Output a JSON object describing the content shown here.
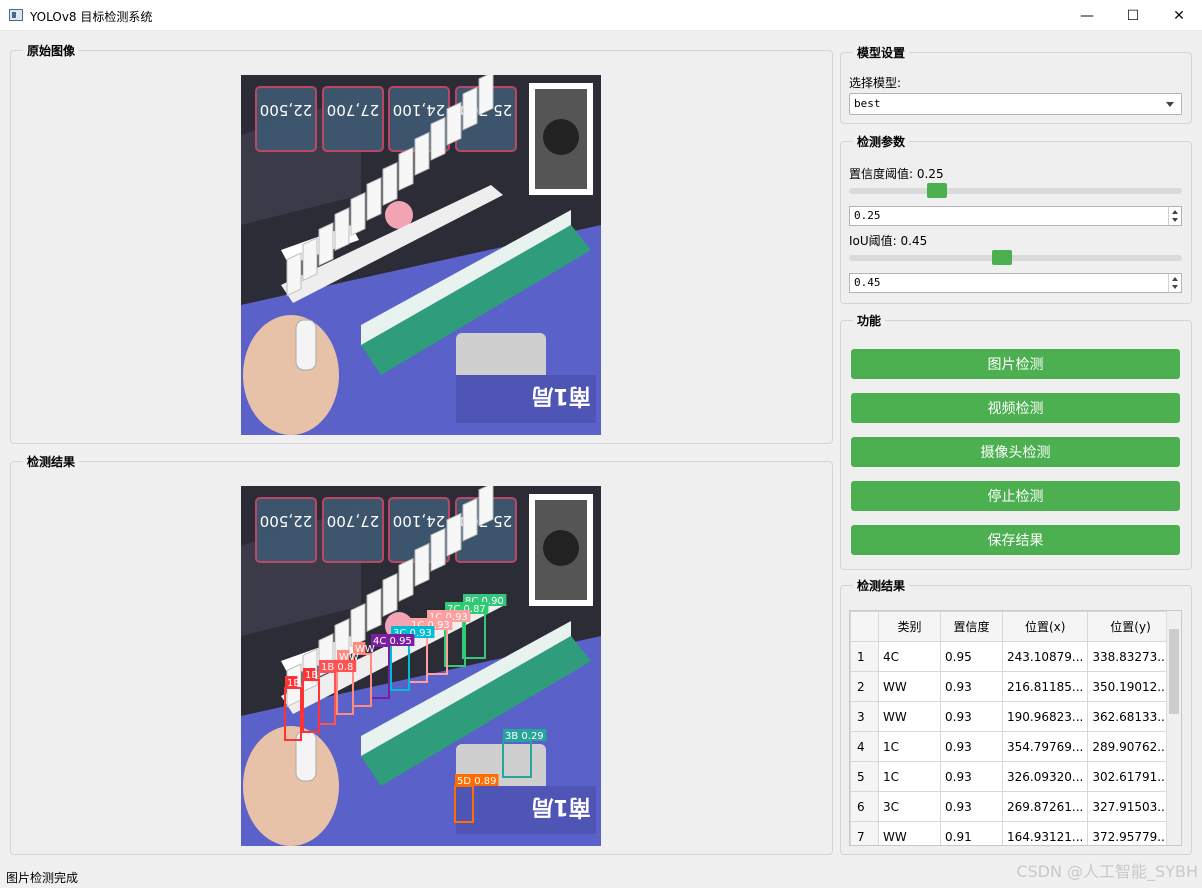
{
  "window": {
    "title": "YOLOv8 目标检测系统",
    "minimize": "—",
    "maximize": "☐",
    "close": "✕"
  },
  "original_panel": {
    "title": "原始图像"
  },
  "result_panel": {
    "title": "检测结果"
  },
  "scoreboard": {
    "scores": [
      "25,700",
      "24,100",
      "27,700",
      "22,500"
    ],
    "round": "南1局"
  },
  "detections_overlay": [
    {
      "label": "8C 0.90",
      "color": "#34c77b"
    },
    {
      "label": "7C 0.87",
      "color": "#2ecc71"
    },
    {
      "label": "1C 0.93",
      "color": "#ff9f9f"
    },
    {
      "label": "3C 0.93",
      "color": "#00bcd4"
    },
    {
      "label": "4C 0.95",
      "color": "#7b1fa2"
    },
    {
      "label": "WW",
      "color": "#ff8a80"
    },
    {
      "label": "1B 0.8",
      "color": "#ff5252"
    },
    {
      "label": "1B",
      "color": "#ff3333"
    },
    {
      "label": "3B 0.29",
      "color": "#26a69a"
    },
    {
      "label": "5D 0.89",
      "color": "#ff6d00"
    }
  ],
  "model_settings": {
    "title": "模型设置",
    "select_label": "选择模型:",
    "selected_model": "best"
  },
  "detection_params": {
    "title": "检测参数",
    "conf_label": "置信度阈值: 0.25",
    "conf_value": "0.25",
    "conf_fraction": 0.25,
    "iou_label": "IoU阈值: 0.45",
    "iou_value": "0.45",
    "iou_fraction": 0.45
  },
  "functions": {
    "title": "功能",
    "buttons": [
      "图片检测",
      "视频检测",
      "摄像头检测",
      "停止检测",
      "保存结果"
    ]
  },
  "results_table": {
    "title": "检测结果",
    "headers": [
      "类别",
      "置信度",
      "位置(x)",
      "位置(y)"
    ],
    "rows": [
      {
        "n": "1",
        "cls": "4C",
        "conf": "0.95",
        "x": "243.10879...",
        "y": "338.83273..."
      },
      {
        "n": "2",
        "cls": "WW",
        "conf": "0.93",
        "x": "216.81185...",
        "y": "350.19012..."
      },
      {
        "n": "3",
        "cls": "WW",
        "conf": "0.93",
        "x": "190.96823...",
        "y": "362.68133..."
      },
      {
        "n": "4",
        "cls": "1C",
        "conf": "0.93",
        "x": "354.79769...",
        "y": "289.90762..."
      },
      {
        "n": "5",
        "cls": "1C",
        "conf": "0.93",
        "x": "326.09320...",
        "y": "302.61791..."
      },
      {
        "n": "6",
        "cls": "3C",
        "conf": "0.93",
        "x": "269.87261...",
        "y": "327.91503..."
      },
      {
        "n": "7",
        "cls": "WW",
        "conf": "0.91",
        "x": "164.93121...",
        "y": "372.95779..."
      }
    ]
  },
  "status_text": "图片检测完成",
  "watermark": "CSDN @人工智能_SYBH"
}
